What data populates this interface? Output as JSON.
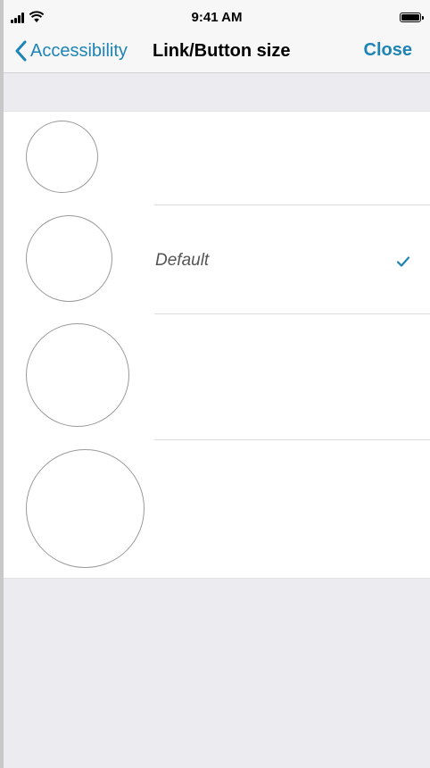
{
  "status_bar": {
    "time": "9:41 AM",
    "icons": [
      "signal-icon",
      "wifi-icon",
      "battery-icon"
    ]
  },
  "nav": {
    "back_label": "Accessibility",
    "title": "Link/Button size",
    "close_label": "Close"
  },
  "sizes": [
    {
      "label": "",
      "selected": false
    },
    {
      "label": "Default",
      "selected": true
    },
    {
      "label": "",
      "selected": false
    },
    {
      "label": "",
      "selected": false
    }
  ],
  "colors": {
    "accent": "#1d84b5",
    "background": "#ebebf0",
    "bar": "#f7f7f7"
  }
}
